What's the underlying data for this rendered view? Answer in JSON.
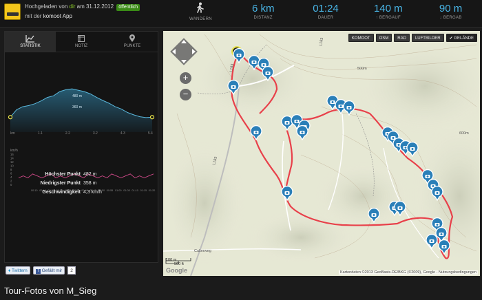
{
  "header": {
    "upload_prefix": "Hochgeladen von",
    "upload_user": "dir",
    "upload_date_text": "am 31.12.2012",
    "visibility_badge": "öffentlich",
    "via_prefix": "mit der",
    "via_app": "komoot App"
  },
  "stats": {
    "activity": "WANDERN",
    "distance_value": "6 km",
    "distance_label": "DISTANZ",
    "duration_value": "01:24",
    "duration_label": "DAUER",
    "ascent_value": "140 m",
    "ascent_label": "↑ BERGAUF",
    "descent_value": "90 m",
    "descent_label": "↓ BERGAB"
  },
  "tabs": [
    "STATISTIK",
    "NOTIZ",
    "PUNKTE"
  ],
  "elevation_chart": {
    "type": "line",
    "max_label": "480 m",
    "min_label": "360 m",
    "x_ticks": [
      "km",
      "1.1",
      "2.2",
      "3.2",
      "4.3",
      "5.4"
    ],
    "values": [
      360,
      392,
      405,
      410,
      418,
      430,
      445,
      452,
      470,
      478,
      482,
      476,
      470,
      460,
      445,
      432,
      420,
      405,
      395,
      380,
      370,
      362,
      358,
      360
    ]
  },
  "hr_chart": {
    "type": "line",
    "unit": "km/h",
    "y_ticks": [
      "16",
      "14",
      "12",
      "10",
      "8",
      "6",
      "4",
      "2",
      "0"
    ],
    "x_ticks": [
      "00:10",
      "00:15",
      "00:20",
      "00:25",
      "00:30",
      "00:35",
      "00:40",
      "00:45",
      "00:50",
      "00:55",
      "01:00",
      "01:05",
      "01:10",
      "01:15",
      "01:20"
    ],
    "values": [
      4,
      5,
      4,
      6,
      5,
      4,
      5,
      6,
      4,
      5,
      4,
      5,
      6,
      5,
      4,
      6,
      5,
      4,
      5,
      4,
      6,
      5,
      4,
      5,
      6,
      4,
      5,
      4,
      5,
      6
    ]
  },
  "info": {
    "highest_label": "Höchster Punkt",
    "highest_value": "482 m",
    "lowest_label": "Niedrigster Punkt",
    "lowest_value": "358 m",
    "speed_label": "Geschwindigkeit",
    "speed_value": "4,3 km/h"
  },
  "social": {
    "twitter": "Twittern",
    "facebook": "Gefällt mir",
    "fb_count": "2"
  },
  "map": {
    "buttons": [
      "KOMOOT",
      "OSM",
      "RAD",
      "LUFTBILDER",
      "✔ GELÄNDE"
    ],
    "labels": {
      "road_l183a": "L183",
      "road_l183b": "L183",
      "road_l183c": "L183",
      "culterweg": "Culterweg",
      "m500": "500m",
      "m600": "600m"
    },
    "scale_m": "100 m",
    "scale_ft": "500 ft",
    "attribution": "Kartendaten ©2013 GeoBasis-DE/BKG (©2009), Google - Nutzungsbedingungen",
    "google": "Google"
  },
  "footer": {
    "title": "Tour-Fotos von M_Sieg"
  },
  "colors": {
    "accent": "#49b5e6",
    "route": "#e8404a",
    "pin": "#2a7fb8",
    "badge": "#3a8a16"
  }
}
